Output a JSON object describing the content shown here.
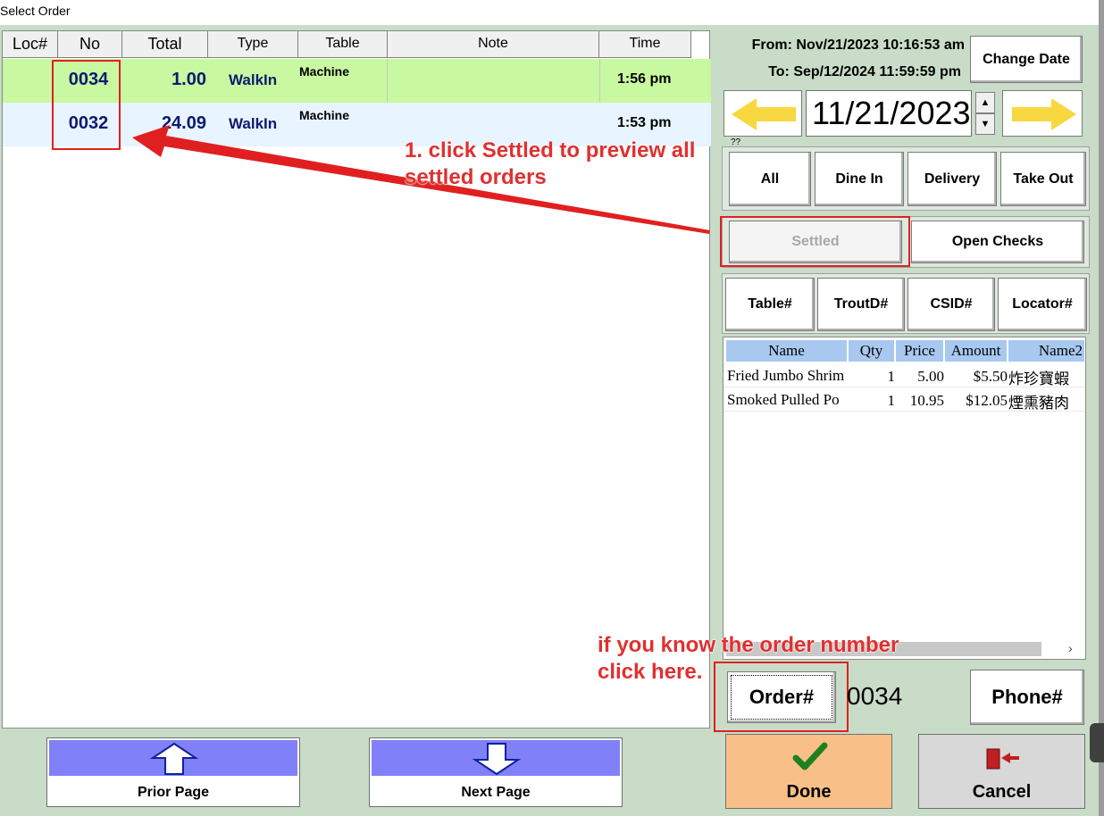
{
  "window": {
    "title": "Select Order"
  },
  "orders": {
    "columns": [
      "Loc#",
      "No",
      "Total",
      "Type",
      "Table",
      "Note",
      "Time"
    ],
    "rows": [
      {
        "loc": "",
        "no": "0034",
        "total": "1.00",
        "type": "WalkIn",
        "table": "Machine",
        "note": "",
        "time": "1:56 pm"
      },
      {
        "loc": "",
        "no": "0032",
        "total": "24.09",
        "type": "WalkIn",
        "table": "Machine",
        "note": "",
        "time": "1:53 pm"
      }
    ]
  },
  "date_range": {
    "from": "From: Nov/21/2023 10:16:53 am",
    "to": "To: Sep/12/2024 11:59:59 pm",
    "change_label": "Change Date",
    "current": "11/21/2023"
  },
  "filter_group_label": "??",
  "filters": {
    "all": "All",
    "dine_in": "Dine In",
    "delivery": "Delivery",
    "take_out": "Take Out"
  },
  "status": {
    "settled": "Settled",
    "open_checks": "Open Checks"
  },
  "search_by": {
    "table": "Table#",
    "troutd": "TroutD#",
    "csid": "CSID#",
    "locator": "Locator#"
  },
  "items": {
    "columns": [
      "Name",
      "Qty",
      "Price",
      "Amount",
      "Name2"
    ],
    "rows": [
      {
        "name": "Fried Jumbo Shrim",
        "qty": "1",
        "price": "5.00",
        "amount": "$5.50",
        "name2": "炸珍寶蝦"
      },
      {
        "name": "Smoked Pulled Po",
        "qty": "1",
        "price": "10.95",
        "amount": "$12.05",
        "name2": "煙熏豬肉"
      }
    ]
  },
  "order_lookup": {
    "button": "Order#",
    "value": "0034",
    "phone": "Phone#"
  },
  "paging": {
    "prior": "Prior Page",
    "next": "Next Page"
  },
  "actions": {
    "done": "Done",
    "cancel": "Cancel"
  },
  "annotations": {
    "settled_line1": "1. click Settled to preview all",
    "settled_line2": "settled orders",
    "order_line1": "if you know the order number",
    "order_line2": "click here."
  },
  "colors": {
    "background": "#c8dcc8",
    "row_selected": "#c8f8a0",
    "row_alt": "#e8f4ff",
    "annotation": "#e02020",
    "done_button": "#f8c088",
    "page_button_top": "#8080f8",
    "arrow_yellow": "#f8d840"
  },
  "icons": {
    "prev_date": "arrow-left-icon",
    "next_date": "arrow-right-icon",
    "prior_page": "arrow-up-icon",
    "next_page": "arrow-down-icon",
    "done": "checkmark-icon",
    "cancel": "exit-door-icon"
  }
}
